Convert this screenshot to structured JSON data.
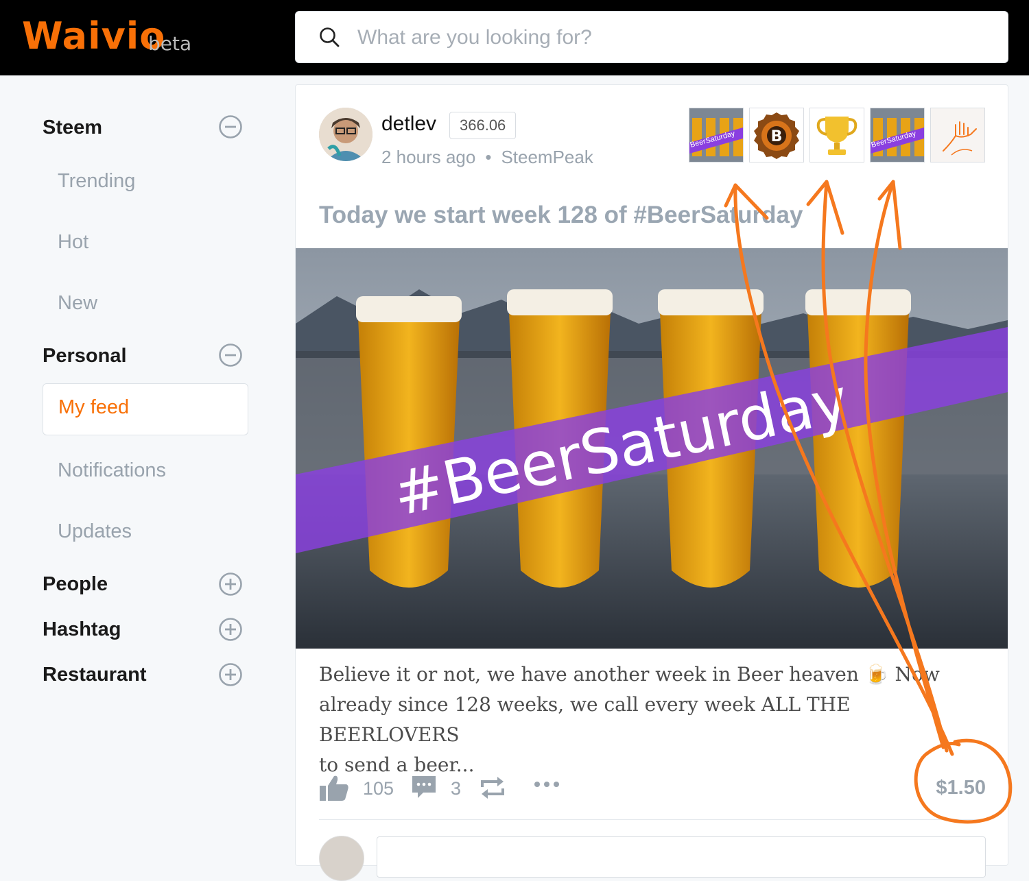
{
  "header": {
    "logo": "Waivio",
    "logo_suffix": "beta",
    "search_placeholder": "What are you looking for?"
  },
  "sidebar": {
    "sections": [
      {
        "title": "Steem",
        "toggle": "minus-circle-icon",
        "items": [
          "Trending",
          "Hot",
          "New"
        ]
      },
      {
        "title": "Personal",
        "toggle": "minus-circle-icon",
        "items": [
          "My feed",
          "Notifications",
          "Updates"
        ],
        "active_item": "My feed"
      },
      {
        "title": "People",
        "toggle": "plus-circle-icon"
      },
      {
        "title": "Hashtag",
        "toggle": "plus-circle-icon"
      },
      {
        "title": "Restaurant",
        "toggle": "plus-circle-icon"
      }
    ]
  },
  "post": {
    "author": "detlev",
    "reputation": "366.06",
    "time": "2 hours ago",
    "app": "SteemPeak",
    "badges": [
      "beersaturday-badge",
      "b-coin-badge",
      "trophy-badge",
      "beersaturday-badge",
      "hand-badge"
    ],
    "badge_text": "BeerSaturday",
    "title": "Today we start week 128 of #BeerSaturday",
    "image_caption": "#BeerSaturday",
    "excerpt_line1": "Believe it or not, we have another week in Beer heaven 🍺 Now",
    "excerpt_line2": "already since 128 weeks, we call every week ALL THE BEERLOVERS",
    "excerpt_line3": "to send a beer...",
    "likes": "105",
    "comments": "3",
    "payout": "$1.50"
  },
  "colors": {
    "brand": "#f87007",
    "muted": "#99a3ad",
    "annotation": "#f5781e",
    "banner": "#8a3fe0"
  }
}
